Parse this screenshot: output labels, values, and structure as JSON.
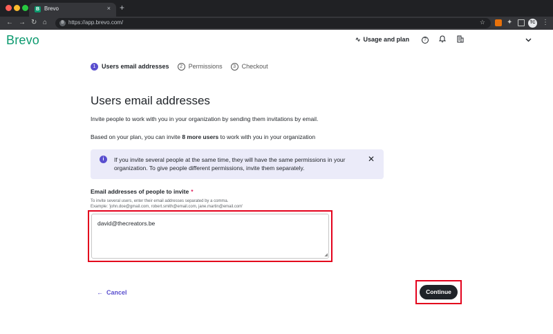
{
  "browser": {
    "tab_title": "Brevo",
    "tab_favicon_letter": "B",
    "tab_close": "×",
    "new_tab": "+",
    "url": "https://app.brevo.com/",
    "profile_initials": "TC",
    "nav": {
      "back": "←",
      "forward": "→",
      "reload": "↻",
      "home": "⌂"
    },
    "star": "☆",
    "menu": "⋮"
  },
  "header": {
    "logo": "Brevo",
    "usage_label": "Usage and plan",
    "usage_icon": "∿",
    "help_icon": "?",
    "bell_icon": "🔔",
    "building_icon": "▥",
    "chevron_icon": "⌄"
  },
  "stepper": {
    "steps": [
      {
        "number": "1",
        "label": "Users email addresses",
        "state": "active"
      },
      {
        "number": "2",
        "label": "Permissions",
        "state": "inactive"
      },
      {
        "number": "3",
        "label": "Checkout",
        "state": "inactive"
      }
    ]
  },
  "main": {
    "title": "Users email addresses",
    "intro": "Invite people to work with you in your organization by sending them invitations by email.",
    "plan_prefix": "Based on your plan, you can invite ",
    "plan_highlight": "8 more users",
    "plan_suffix": " to work with you in your organization",
    "notice": {
      "icon": "i",
      "text": "If you invite several people at the same time, they will have the same permissions in your organization. To give people different permissions, invite them separately.",
      "close": "✕"
    },
    "field": {
      "label": "Email addresses of people to invite",
      "required_mark": "*",
      "hint_line1": "To invite several users, enter their email addresses separated by a comma.",
      "hint_line2": "Example: 'john.doe@gmail.com, robert.smith@email.com, jane.martin@email.com'",
      "value": "david@thecreators.be"
    },
    "cancel_label": "Cancel",
    "cancel_arrow": "←",
    "continue_label": "Continue"
  },
  "colors": {
    "brand_green": "#0b996e",
    "accent_purple": "#5a4fcf",
    "notice_bg": "#ebebf9",
    "highlight_red": "#e3001b",
    "button_dark": "#1f2328"
  }
}
